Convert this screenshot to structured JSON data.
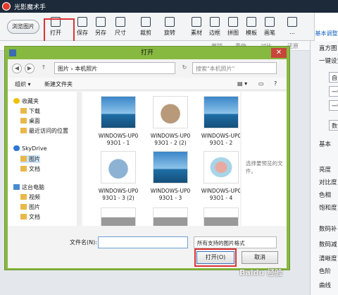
{
  "app": {
    "title": "光影魔术手",
    "browse_label": "浏览图片",
    "toolbar": [
      {
        "label": "打开",
        "icon": "open-icon"
      },
      {
        "label": "保存",
        "icon": "save-icon"
      },
      {
        "label": "另存",
        "icon": "save-as-icon"
      },
      {
        "label": "尺寸",
        "icon": "resize-icon"
      },
      {
        "label": "裁剪",
        "icon": "crop-icon"
      },
      {
        "label": "旋转",
        "icon": "rotate-icon"
      },
      {
        "label": "素材",
        "icon": "material-icon"
      },
      {
        "label": "边框",
        "icon": "border-icon"
      },
      {
        "label": "拼图",
        "icon": "collage-icon"
      },
      {
        "label": "模板",
        "icon": "template-icon"
      },
      {
        "label": "画笔",
        "icon": "brush-icon"
      },
      {
        "label": "...",
        "icon": "more-icon"
      }
    ],
    "right_tab": "基本调整",
    "subbar": [
      "撤销",
      "重做",
      "对比",
      "还原"
    ],
    "right_panel": {
      "items": [
        "直方图",
        "一键设置",
        "自动",
        "一键",
        "一键",
        "数字点",
        "基本",
        "亮度",
        "对比度",
        "色相",
        "饱和度",
        "数码补",
        "数码减",
        "清晰度",
        "色阶",
        "曲线"
      ]
    }
  },
  "dialog": {
    "title": "打开",
    "address": "图片 › 本机照片",
    "search_placeholder": "搜索\"本机照片\"",
    "organize": "组织 ▾",
    "new_folder": "新建文件夹",
    "nav": [
      {
        "label": "收藏夹",
        "type": "star"
      },
      {
        "label": "下载",
        "type": "folder"
      },
      {
        "label": "桌面",
        "type": "folder"
      },
      {
        "label": "最近访问的位置",
        "type": "folder"
      },
      {
        "label": "SkyDrive",
        "type": "cloud"
      },
      {
        "label": "图片",
        "type": "folder"
      },
      {
        "label": "文档",
        "type": "folder"
      },
      {
        "label": "这台电脑",
        "type": "pc"
      },
      {
        "label": "视频",
        "type": "folder"
      },
      {
        "label": "图片",
        "type": "folder"
      },
      {
        "label": "文档",
        "type": "folder"
      }
    ],
    "files": [
      {
        "name": "WINDOWS-UP0 93O1 - 1",
        "kind": "sky"
      },
      {
        "name": "WINDOWS-UP0 93O1 - 2 (2)",
        "kind": "shirt"
      },
      {
        "name": "WINDOWS-UP0 93O1 - 2",
        "kind": "sky"
      },
      {
        "name": "WINDOWS-UP0 93O1 - 3 (2)",
        "kind": "shorts"
      },
      {
        "name": "WINDOWS-UP0 93O1 - 3",
        "kind": "sky"
      },
      {
        "name": "WINDOWS-UP0 93O1 - 4",
        "kind": "sweater"
      }
    ],
    "preview_hint": "选择要预览的文件。",
    "filename_label": "文件名(N):",
    "filename_value": "",
    "filter": "所有支持的图片格式",
    "open_button": "打开(O)",
    "cancel_button": "取消",
    "close_glyph": "✕"
  },
  "watermark": "Baidu 经验"
}
